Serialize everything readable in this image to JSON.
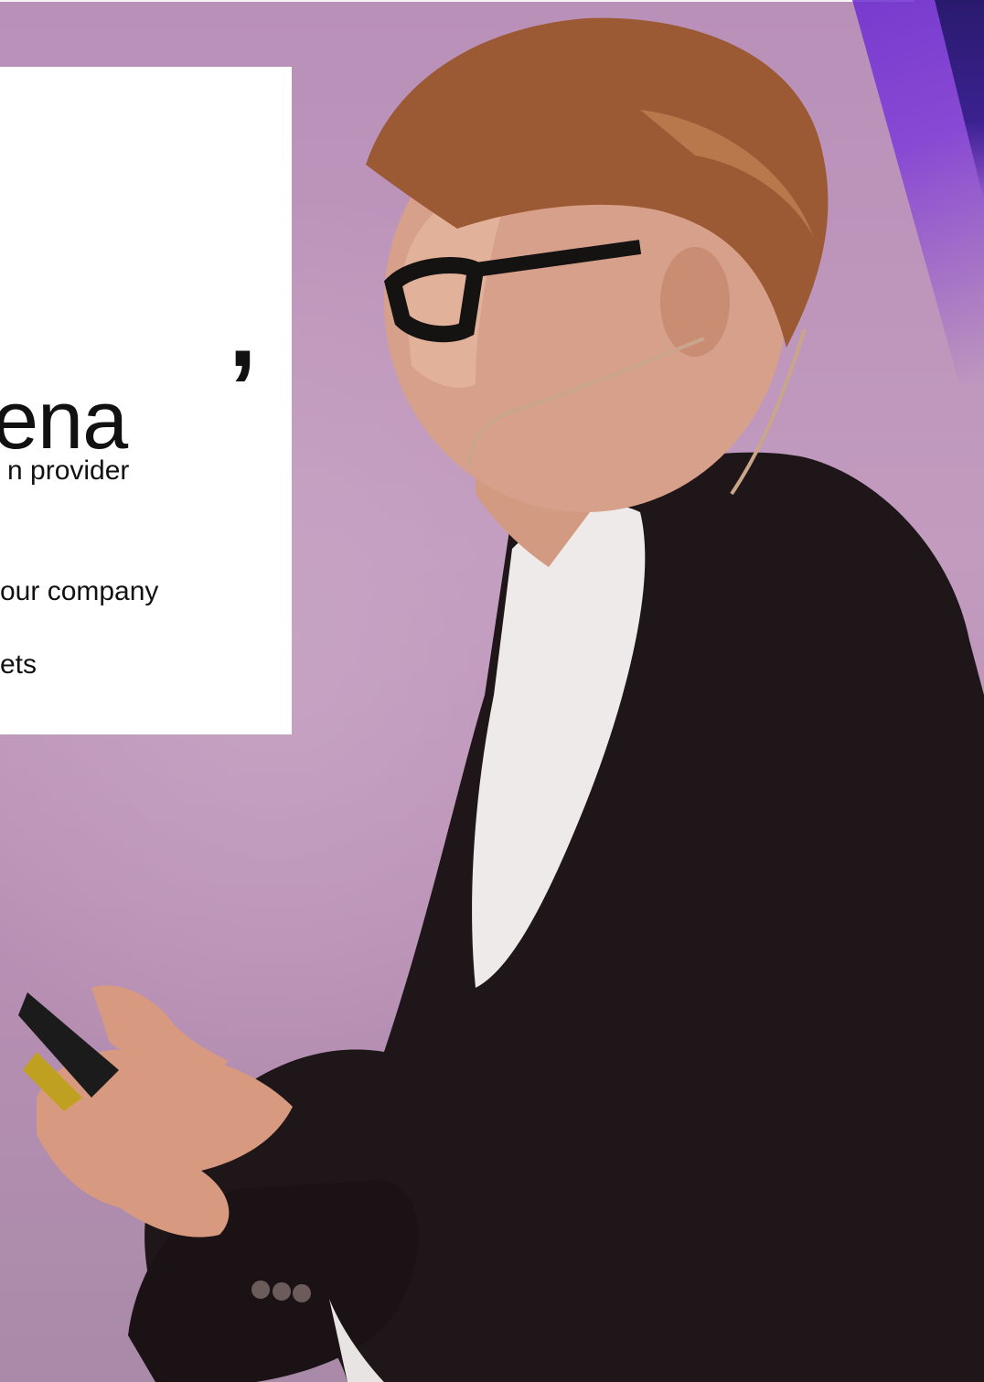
{
  "hero": {
    "headline_comma": ",",
    "headline": "ena",
    "lines": [
      "n provider",
      "our company",
      "ets"
    ]
  },
  "colors": {
    "background": "#b990b8",
    "accent_violet": "#7f3cd8",
    "accent_navy": "#2a1a6e",
    "card": "#ffffff",
    "text": "#111111"
  }
}
